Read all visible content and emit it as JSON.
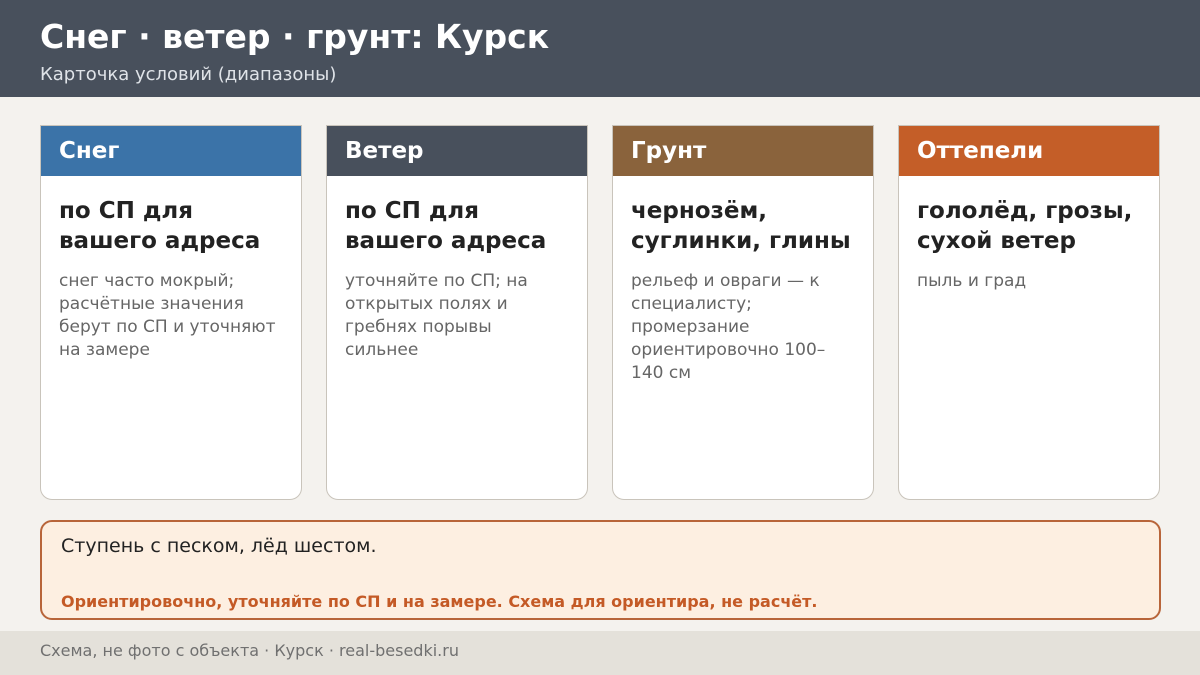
{
  "header": {
    "title": "Снег · ветер · грунт: Курск",
    "subtitle": "Карточка условий (диапазоны)"
  },
  "cards": [
    {
      "heading": "Снег",
      "main": "по СП для вашего адреса",
      "note": "снег часто мокрый; расчётные значения берут по СП и уточняют на замере",
      "color": "#3b73a8"
    },
    {
      "heading": "Ветер",
      "main": "по СП для вашего адреса",
      "note": "уточняйте по СП; на открытых полях и гребнях порывы сильнее",
      "color": "#48505c"
    },
    {
      "heading": "Грунт",
      "main": "чернозём, суглинки, глины",
      "note": "рельеф и овраги — к специалисту; промерзание ориентировочно 100–140 см",
      "color": "#8a633c"
    },
    {
      "heading": "Оттепели",
      "main": "гололёд, грозы, сухой ветер",
      "note": "пыль и град",
      "color": "#c45e28"
    }
  ],
  "note_box": {
    "text": "Ступень с песком, лёд шестом.",
    "warning": "Ориентировочно, уточняйте по СП и на замере. Схема для ориентира, не расчёт."
  },
  "footer": {
    "text": "Схема, не фото с объекта  ·  Курск  ·  real-besedki.ru"
  }
}
